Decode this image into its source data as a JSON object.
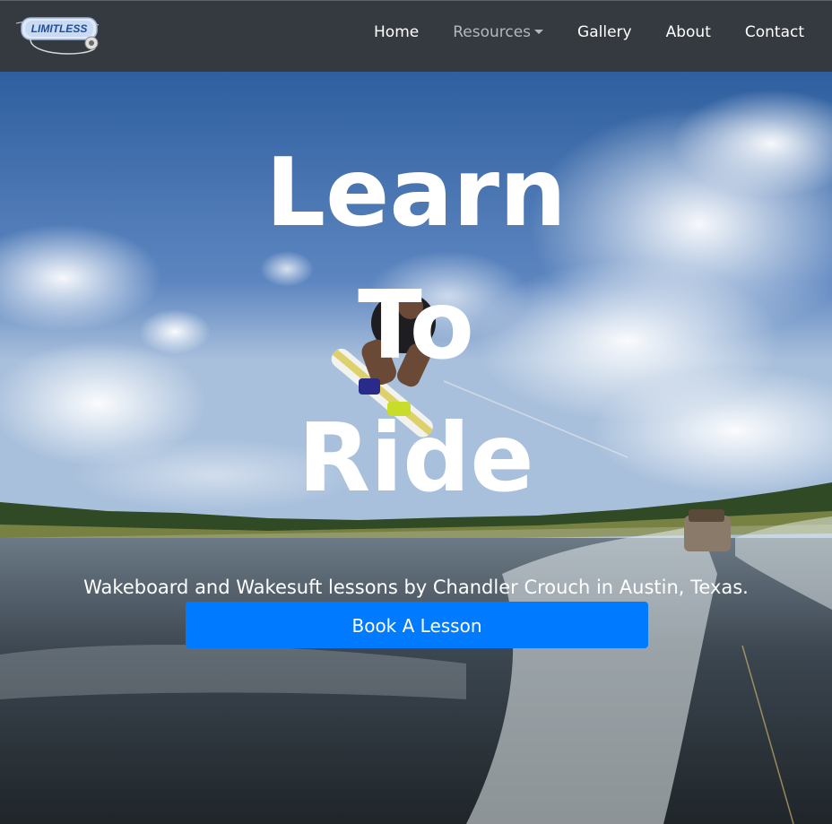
{
  "brand": {
    "logo_text": "LIMITLESS"
  },
  "nav": {
    "home": "Home",
    "resources": "Resources",
    "gallery": "Gallery",
    "about": "About",
    "contact": "Contact"
  },
  "hero": {
    "line1": "Learn",
    "line2": "To",
    "line3": "Ride",
    "tagline": "Wakeboard and Wakesuft lessons by Chandler Crouch in Austin, Texas.",
    "cta": "Book A Lesson"
  },
  "colors": {
    "navbar": "#343a40",
    "cta": "#007bff",
    "text": "#ffffff"
  }
}
